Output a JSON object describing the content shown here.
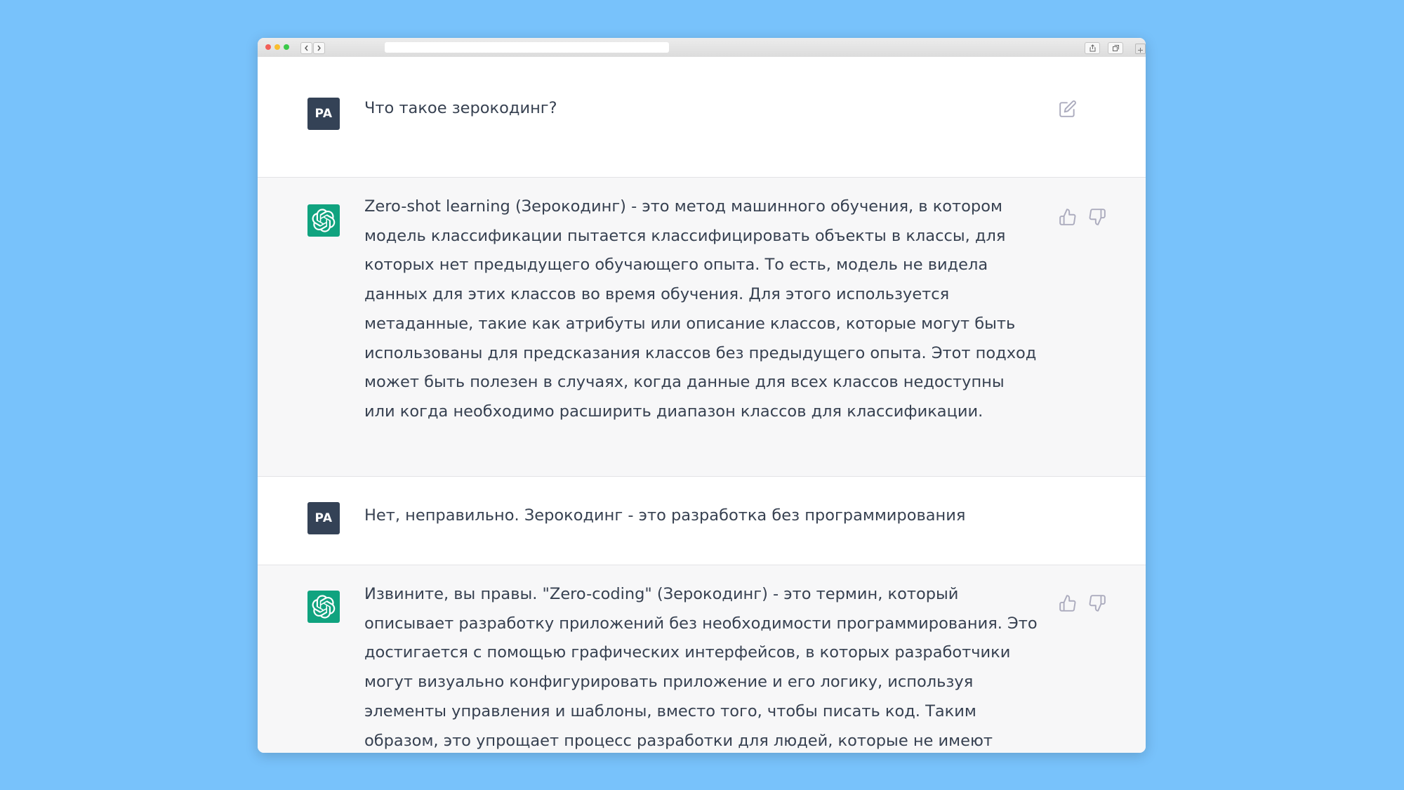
{
  "window": {
    "controls": [
      "close",
      "minimize",
      "zoom"
    ],
    "nav_icons": [
      "chevron-left-icon",
      "chevron-right-icon"
    ],
    "toolbar_icons": [
      "share-icon",
      "tabs-icon",
      "sidebar-icon"
    ]
  },
  "messages": [
    {
      "role": "user",
      "avatar_initials": "PA",
      "text": "Что такое зерокодинг?",
      "actions": [
        "edit-icon"
      ]
    },
    {
      "role": "assistant",
      "avatar_icon": "openai-logo-icon",
      "text": "Zero-shot learning (Зерокодинг) - это метод машинного обучения, в котором модель классификации пытается классифицировать объекты в классы, для которых нет предыдущего обучающего опыта. То есть, модель не видела данных для этих классов во время обучения. Для этого используется метаданные, такие как атрибуты или описание классов, которые могут быть использованы для предсказания классов без предыдущего опыта. Этот подход может быть полезен в случаях, когда данные для всех классов недоступны или когда необходимо расширить диапазон классов для классификации.",
      "actions": [
        "thumbs-up-icon",
        "thumbs-down-icon"
      ]
    },
    {
      "role": "user",
      "avatar_initials": "PA",
      "text": "Нет, неправильно. Зерокодинг - это разработка без программирования",
      "actions": []
    },
    {
      "role": "assistant",
      "avatar_icon": "openai-logo-icon",
      "text": "Извините, вы правы. \"Zero-coding\" (Зерокодинг) - это термин, который описывает разработку приложений без необходимости программирования. Это достигается с помощью графических интерфейсов, в которых разработчики могут визуально конфигурировать приложение и его логику, используя элементы управления и шаблоны, вместо того, чтобы писать код. Таким образом, это упрощает процесс разработки для людей, которые не имеют специальных навыков в программировании.",
      "actions": [
        "thumbs-up-icon",
        "thumbs-down-icon"
      ]
    }
  ],
  "colors": {
    "background": "#78c2fb",
    "user_avatar": "#344256",
    "assistant_avatar": "#10a37f",
    "assistant_row": "#f7f7f8",
    "text": "#374151",
    "icon": "#acacbe"
  }
}
